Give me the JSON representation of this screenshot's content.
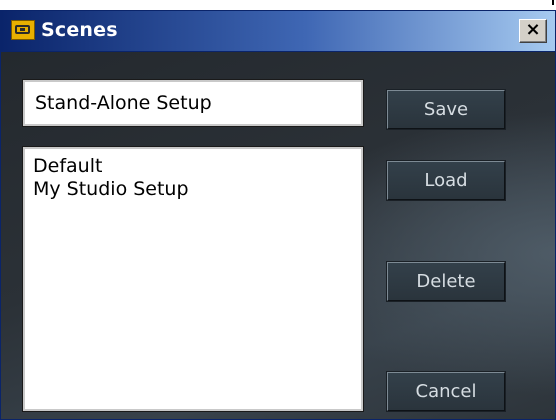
{
  "window": {
    "title": "Scenes",
    "close_label": "×",
    "title_icon": "scene-icon"
  },
  "scene_name": {
    "value": "Stand-Alone Setup"
  },
  "scenes": {
    "items": [
      {
        "label": "Default"
      },
      {
        "label": "My Studio Setup"
      }
    ]
  },
  "buttons": {
    "save": "Save",
    "load": "Load",
    "delete": "Delete",
    "cancel": "Cancel"
  },
  "colors": {
    "titlebar_start": "#0a246a",
    "titlebar_end": "#a6caf0",
    "panel_background": "#2b3137",
    "button_text": "#d6dde2"
  }
}
